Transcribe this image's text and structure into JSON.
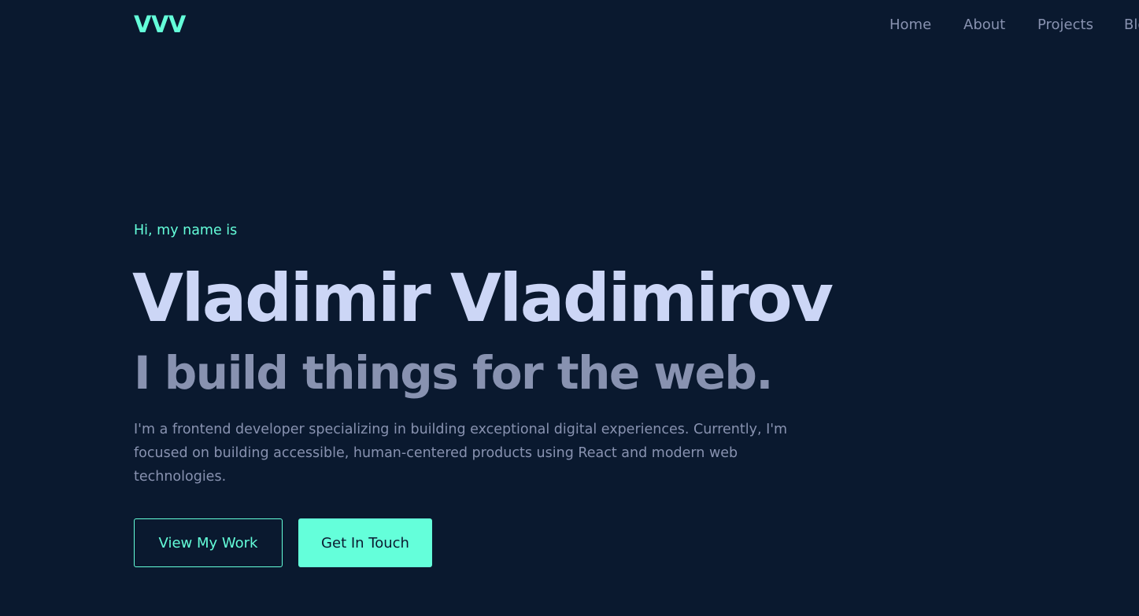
{
  "header": {
    "logo": "VVV",
    "nav": [
      "Home",
      "About",
      "Projects",
      "Blog"
    ]
  },
  "hero": {
    "intro": "Hi, my name is",
    "name": "Vladimir Vladimirov",
    "tagline": "I build things for the web.",
    "bio": "I'm a frontend developer specializing in building exceptional digital experiences. Currently, I'm focused on building accessible, human-centered products using React and modern web technologies.",
    "primary_button": "View My Work",
    "secondary_button": "Get In Touch"
  },
  "colors": {
    "background": "#0a192f",
    "accent": "#64ffda",
    "heading": "#ccd6f6",
    "muted": "#8892b0"
  }
}
